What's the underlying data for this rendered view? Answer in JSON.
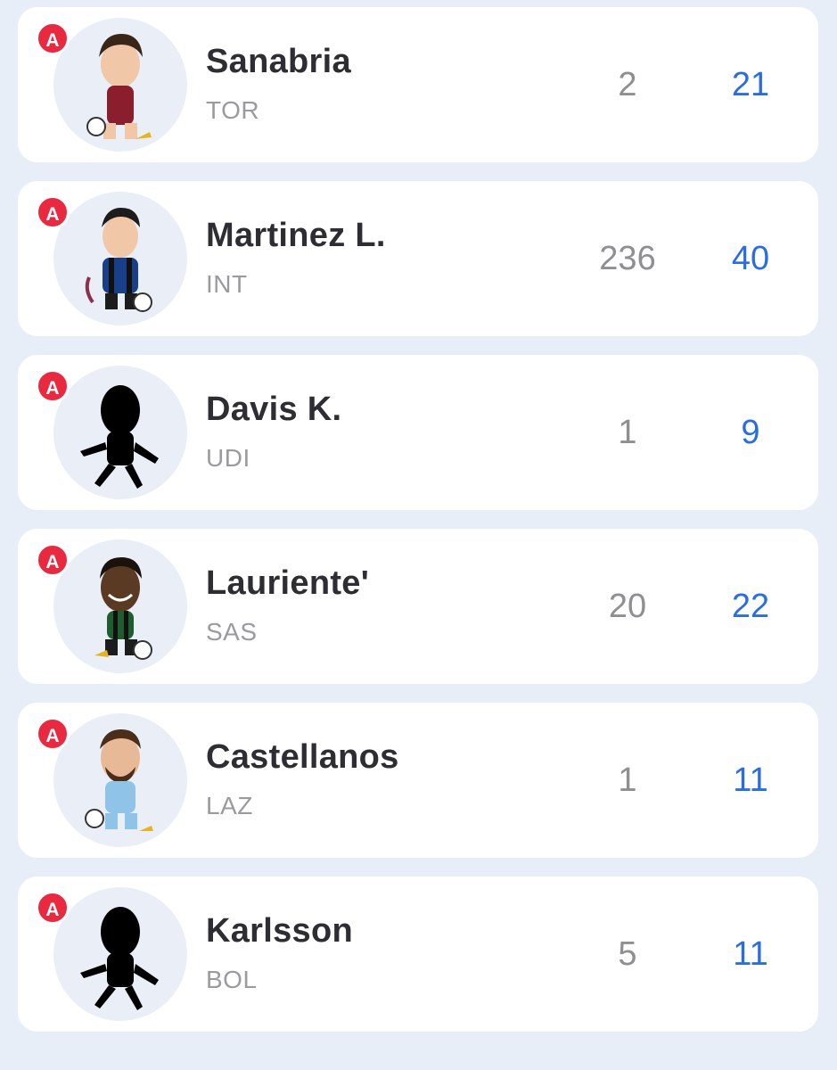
{
  "players": [
    {
      "badge": "A",
      "name": "Sanabria",
      "team": "TOR",
      "stat_left": "2",
      "stat_right": "21",
      "avatar": "cartoon-player-red"
    },
    {
      "badge": "A",
      "name": "Martinez L.",
      "team": "INT",
      "stat_left": "236",
      "stat_right": "40",
      "avatar": "cartoon-player-blue-black"
    },
    {
      "badge": "A",
      "name": "Davis K.",
      "team": "UDI",
      "stat_left": "1",
      "stat_right": "9",
      "avatar": "silhouette"
    },
    {
      "badge": "A",
      "name": "Lauriente'",
      "team": "SAS",
      "stat_left": "20",
      "stat_right": "22",
      "avatar": "cartoon-player-green-black"
    },
    {
      "badge": "A",
      "name": "Castellanos",
      "team": "LAZ",
      "stat_left": "1",
      "stat_right": "11",
      "avatar": "cartoon-player-light-blue"
    },
    {
      "badge": "A",
      "name": "Karlsson",
      "team": "BOL",
      "stat_left": "5",
      "stat_right": "11",
      "avatar": "silhouette"
    }
  ],
  "colors": {
    "background": "#e8eef8",
    "card": "#ffffff",
    "badge": "#e8293f",
    "accent_stat": "#2a6de0",
    "muted_stat": "#8e8e93",
    "name": "#2d2d33",
    "team": "#9a9a9f"
  }
}
